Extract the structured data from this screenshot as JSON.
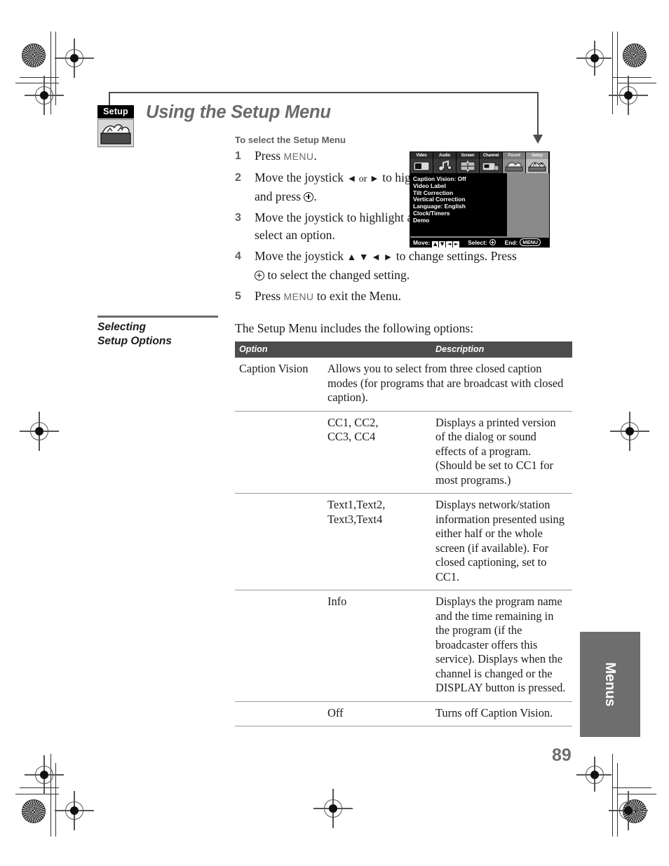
{
  "document": {
    "page_number": "89",
    "thumb_tab_label": "Menus",
    "title": "Using the Setup Menu",
    "badge_label": "Setup"
  },
  "procedure": {
    "heading": "To select the Setup Menu",
    "steps": [
      {
        "num": "1",
        "prefix": "Press ",
        "kbd": "MENU",
        "suffix": "."
      },
      {
        "num": "2",
        "prefix": "Move the joystick ",
        "arrows": "◄ or ►",
        "mid": " to highlight the Setup icon and press ",
        "suffix": "."
      },
      {
        "num": "3",
        "prefix": "Move the joystick to highlight an option. Press ",
        "mid": " to select an option.",
        "suffix": ""
      },
      {
        "num": "4",
        "prefix": "Move the joystick ",
        "arrows": "▲ ▼ ◄ ►",
        "mid": " to change settings. Press ",
        "suffix": " to select the changed setting."
      },
      {
        "num": "5",
        "prefix": "Press ",
        "kbd": "MENU",
        "suffix": " to exit the Menu."
      }
    ]
  },
  "tv_menu": {
    "tabs": [
      {
        "label": "Video",
        "state": "normal"
      },
      {
        "label": "Audio",
        "state": "normal"
      },
      {
        "label": "Screen",
        "state": "normal"
      },
      {
        "label": "Channel",
        "state": "normal"
      },
      {
        "label": "Parent",
        "state": "dim"
      },
      {
        "label": "Setup",
        "state": "selected"
      }
    ],
    "items": [
      "Caption Vision: Off",
      "Video Label",
      "Tilt Correction",
      "Vertical Correction",
      "Language: English",
      "Clock/Timers",
      "Demo"
    ],
    "status_bar": {
      "move_label": "Move:",
      "keys": [
        "▲",
        "▼",
        "◄",
        "►"
      ],
      "select_label": "Select:",
      "end_label": "End:",
      "end_key": "MENU"
    }
  },
  "section": {
    "heading_line1": "Selecting",
    "heading_line2": "Setup Options",
    "intro": "The Setup Menu includes the following options:"
  },
  "table": {
    "headers": {
      "option": "Option",
      "description": "Description"
    },
    "rows": [
      {
        "option": "Caption Vision",
        "sub": "",
        "description": "Allows you to select from three closed caption modes (for programs that are broadcast with closed caption)."
      },
      {
        "option": "",
        "sub": "CC1, CC2,\nCC3, CC4",
        "description": "Displays a printed version of the dialog or sound effects of a program. (Should be set to CC1 for most programs.)"
      },
      {
        "option": "",
        "sub": "Text1,Text2,\nText3,Text4",
        "description": "Displays network/station information presented using either half or the whole screen (if available). For closed captioning, set to CC1."
      },
      {
        "option": "",
        "sub": "Info",
        "description": "Displays the program name and the time remaining in the program (if the broadcaster offers this service). Displays when the channel is changed or the DISPLAY button is pressed."
      },
      {
        "option": "",
        "sub": "Off",
        "description": "Turns off Caption Vision."
      }
    ]
  },
  "colors": {
    "title_gray": "#6a6a6a",
    "table_header_bg": "#4d4d4d",
    "thumb_tab_bg": "#6e6e6e",
    "rule_gray": "#9a9a9a"
  }
}
